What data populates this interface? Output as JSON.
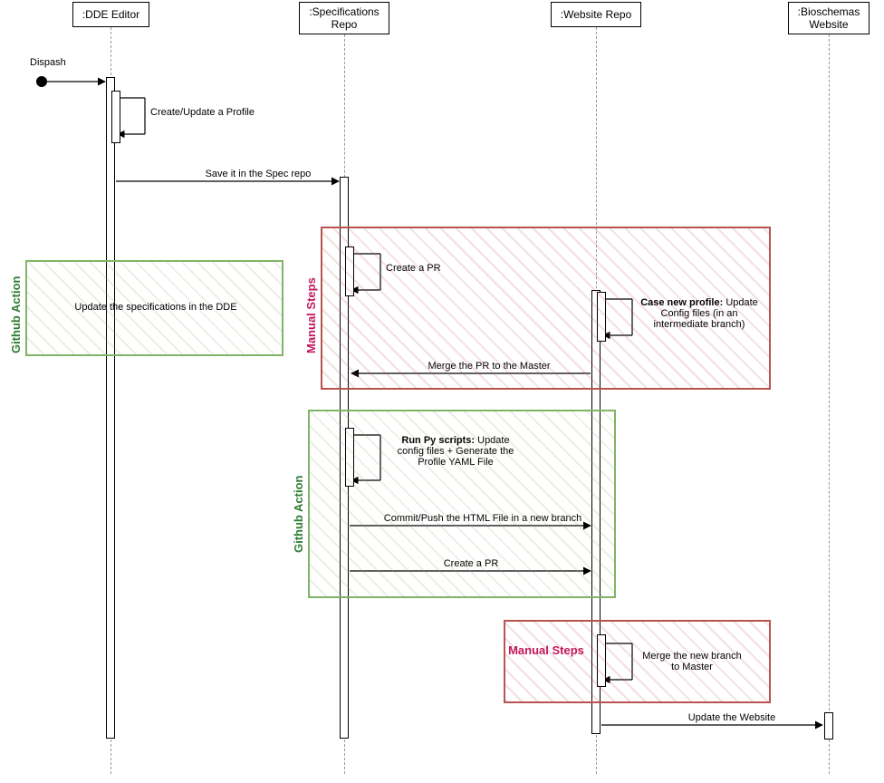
{
  "participants": {
    "dde": {
      "label": ":DDE Editor"
    },
    "spec": {
      "label": ":Specifications Repo"
    },
    "web": {
      "label": ":Website Repo"
    },
    "site": {
      "label": ":Bioschemas Website"
    }
  },
  "dispatch": "Dispash",
  "messages": {
    "create_profile": "Create/Update a Profile",
    "save_spec": "Save it in the Spec repo",
    "update_dde": "Update the specifications in the DDE",
    "create_pr_spec": "Create a PR",
    "case_new_profile_bold": "Case new profile:",
    "case_new_profile_rest": "Update Config files (in an intermediate branch)",
    "merge_master": "Merge the PR to the Master",
    "run_py_bold": "Run Py scripts:",
    "run_py_rest": "Update config files + Generate the Profile YAML File",
    "commit_push": "Commit/Push the HTML File in a new branch",
    "create_pr_web": "Create a PR",
    "merge_new_branch": "Merge the new branch to Master",
    "update_website": "Update the Website"
  },
  "zones": {
    "github_action": "Github Action",
    "manual_steps": "Manual Steps",
    "manual_steps2": "Manual Steps"
  },
  "colors": {
    "green_border": "#82b366",
    "red_border": "#b85450",
    "green_text": "#2e7d32",
    "red_text": "#c2185b"
  }
}
